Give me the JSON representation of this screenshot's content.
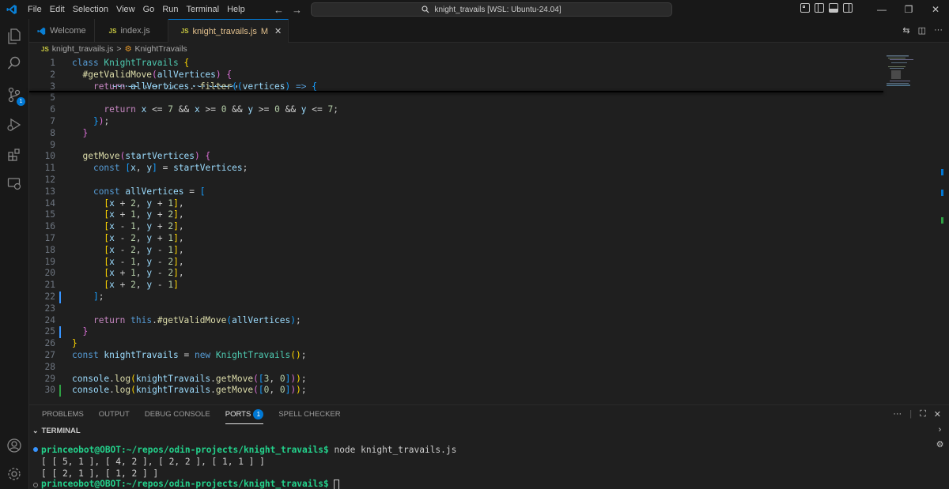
{
  "menu": [
    "File",
    "Edit",
    "Selection",
    "View",
    "Go",
    "Run",
    "Terminal",
    "Help"
  ],
  "search": {
    "text": "knight_travails [WSL: Ubuntu-24.04]"
  },
  "tabs": [
    {
      "label": "Welcome",
      "icon": "vscode-logo-icon"
    },
    {
      "label": "index.js",
      "icon": "js"
    },
    {
      "label": "knight_travails.js",
      "icon": "js",
      "modified": "M",
      "active": true
    }
  ],
  "js_badge": "JS",
  "breadcrumb": {
    "file": "knight_travails.js",
    "separator": ">",
    "symbol": "KnightTravails"
  },
  "editor_lines": [
    {
      "n": "1",
      "parts": [
        [
          "k",
          "class "
        ],
        [
          "cls",
          "KnightTravails "
        ],
        [
          "p",
          "{"
        ]
      ]
    },
    {
      "n": "2",
      "parts": [
        [
          "",
          "  "
        ],
        [
          "f",
          "#getValidMove"
        ],
        [
          "p2",
          "("
        ],
        [
          "v",
          "allVertices"
        ],
        [
          "p2",
          ")"
        ],
        [
          "",
          " "
        ],
        [
          "p2",
          "{"
        ]
      ]
    },
    {
      "n": "3",
      "parts": [
        [
          "",
          "    "
        ],
        [
          "c",
          "return "
        ],
        [
          "v",
          "allVertices"
        ],
        [
          "",
          ". "
        ],
        [
          "f",
          "filter"
        ],
        [
          "p3",
          "(("
        ],
        [
          "v",
          "vertices"
        ],
        [
          "p3",
          ")"
        ],
        [
          "",
          " "
        ],
        [
          "k",
          "=>"
        ],
        [
          "",
          " "
        ],
        [
          "p3",
          "{"
        ]
      ]
    },
    {
      "n": "5",
      "parts": []
    },
    {
      "n": "6",
      "parts": [
        [
          "",
          "      "
        ],
        [
          "c",
          "return "
        ],
        [
          "v",
          "x "
        ],
        [
          "",
          "<= "
        ],
        [
          "n",
          "7 "
        ],
        [
          "",
          "&& "
        ],
        [
          "v",
          "x "
        ],
        [
          "",
          ">= "
        ],
        [
          "n",
          "0 "
        ],
        [
          "",
          "&& "
        ],
        [
          "v",
          "y "
        ],
        [
          "",
          ">= "
        ],
        [
          "n",
          "0 "
        ],
        [
          "",
          "&& "
        ],
        [
          "v",
          "y "
        ],
        [
          "",
          "<= "
        ],
        [
          "n",
          "7"
        ],
        [
          "",
          ";"
        ]
      ]
    },
    {
      "n": "7",
      "parts": [
        [
          "",
          "    "
        ],
        [
          "p3",
          "}"
        ],
        [
          "p2",
          ")"
        ],
        [
          "",
          ";"
        ]
      ]
    },
    {
      "n": "8",
      "parts": [
        [
          "",
          "  "
        ],
        [
          "p2",
          "}"
        ]
      ]
    },
    {
      "n": "9",
      "parts": []
    },
    {
      "n": "10",
      "parts": [
        [
          "",
          "  "
        ],
        [
          "f",
          "getMove"
        ],
        [
          "p2",
          "("
        ],
        [
          "v",
          "startVertices"
        ],
        [
          "p2",
          ")"
        ],
        [
          "",
          " "
        ],
        [
          "p2",
          "{"
        ]
      ]
    },
    {
      "n": "11",
      "parts": [
        [
          "",
          "    "
        ],
        [
          "k",
          "const "
        ],
        [
          "p3",
          "["
        ],
        [
          "v",
          "x"
        ],
        [
          "",
          ", "
        ],
        [
          "v",
          "y"
        ],
        [
          "p3",
          "]"
        ],
        [
          "",
          " = "
        ],
        [
          "v",
          "startVertices"
        ],
        [
          "",
          ";"
        ]
      ]
    },
    {
      "n": "12",
      "parts": []
    },
    {
      "n": "13",
      "parts": [
        [
          "",
          "    "
        ],
        [
          "k",
          "const "
        ],
        [
          "v",
          "allVertices "
        ],
        [
          "",
          "= "
        ],
        [
          "p3",
          "["
        ]
      ]
    },
    {
      "n": "14",
      "parts": [
        [
          "",
          "      "
        ],
        [
          "p",
          "["
        ],
        [
          "v",
          "x "
        ],
        [
          "",
          "+ "
        ],
        [
          "n",
          "2"
        ],
        [
          "",
          ", "
        ],
        [
          "v",
          "y "
        ],
        [
          "",
          "+ "
        ],
        [
          "n",
          "1"
        ],
        [
          "p",
          "]"
        ],
        [
          "",
          ","
        ]
      ]
    },
    {
      "n": "15",
      "parts": [
        [
          "",
          "      "
        ],
        [
          "p",
          "["
        ],
        [
          "v",
          "x "
        ],
        [
          "",
          "+ "
        ],
        [
          "n",
          "1"
        ],
        [
          "",
          ", "
        ],
        [
          "v",
          "y "
        ],
        [
          "",
          "+ "
        ],
        [
          "n",
          "2"
        ],
        [
          "p",
          "]"
        ],
        [
          "",
          ","
        ]
      ]
    },
    {
      "n": "16",
      "parts": [
        [
          "",
          "      "
        ],
        [
          "p",
          "["
        ],
        [
          "v",
          "x "
        ],
        [
          "",
          "- "
        ],
        [
          "n",
          "1"
        ],
        [
          "",
          ", "
        ],
        [
          "v",
          "y "
        ],
        [
          "",
          "+ "
        ],
        [
          "n",
          "2"
        ],
        [
          "p",
          "]"
        ],
        [
          "",
          ","
        ]
      ]
    },
    {
      "n": "17",
      "parts": [
        [
          "",
          "      "
        ],
        [
          "p",
          "["
        ],
        [
          "v",
          "x "
        ],
        [
          "",
          "- "
        ],
        [
          "n",
          "2"
        ],
        [
          "",
          ", "
        ],
        [
          "v",
          "y "
        ],
        [
          "",
          "+ "
        ],
        [
          "n",
          "1"
        ],
        [
          "p",
          "]"
        ],
        [
          "",
          ","
        ]
      ]
    },
    {
      "n": "18",
      "parts": [
        [
          "",
          "      "
        ],
        [
          "p",
          "["
        ],
        [
          "v",
          "x "
        ],
        [
          "",
          "- "
        ],
        [
          "n",
          "2"
        ],
        [
          "",
          ", "
        ],
        [
          "v",
          "y "
        ],
        [
          "",
          "- "
        ],
        [
          "n",
          "1"
        ],
        [
          "p",
          "]"
        ],
        [
          "",
          ","
        ]
      ]
    },
    {
      "n": "19",
      "parts": [
        [
          "",
          "      "
        ],
        [
          "p",
          "["
        ],
        [
          "v",
          "x "
        ],
        [
          "",
          "- "
        ],
        [
          "n",
          "1"
        ],
        [
          "",
          ", "
        ],
        [
          "v",
          "y "
        ],
        [
          "",
          "- "
        ],
        [
          "n",
          "2"
        ],
        [
          "p",
          "]"
        ],
        [
          "",
          ","
        ]
      ]
    },
    {
      "n": "20",
      "parts": [
        [
          "",
          "      "
        ],
        [
          "p",
          "["
        ],
        [
          "v",
          "x "
        ],
        [
          "",
          "+ "
        ],
        [
          "n",
          "1"
        ],
        [
          "",
          ", "
        ],
        [
          "v",
          "y "
        ],
        [
          "",
          "- "
        ],
        [
          "n",
          "2"
        ],
        [
          "p",
          "]"
        ],
        [
          "",
          ","
        ]
      ]
    },
    {
      "n": "21",
      "parts": [
        [
          "",
          "      "
        ],
        [
          "p",
          "["
        ],
        [
          "v",
          "x "
        ],
        [
          "",
          "+ "
        ],
        [
          "n",
          "2"
        ],
        [
          "",
          ", "
        ],
        [
          "v",
          "y "
        ],
        [
          "",
          "- "
        ],
        [
          "n",
          "1"
        ],
        [
          "p",
          "]"
        ]
      ]
    },
    {
      "n": "22",
      "parts": [
        [
          "",
          "    "
        ],
        [
          "p3",
          "]"
        ],
        [
          "",
          ";"
        ]
      ]
    },
    {
      "n": "23",
      "parts": []
    },
    {
      "n": "24",
      "parts": [
        [
          "",
          "    "
        ],
        [
          "c",
          "return "
        ],
        [
          "k",
          "this"
        ],
        [
          "",
          "."
        ],
        [
          "f",
          "#getValidMove"
        ],
        [
          "p3",
          "("
        ],
        [
          "v",
          "allVertices"
        ],
        [
          "p3",
          ")"
        ],
        [
          "",
          ";"
        ]
      ]
    },
    {
      "n": "25",
      "parts": [
        [
          "",
          "  "
        ],
        [
          "p2",
          "}"
        ]
      ]
    },
    {
      "n": "26",
      "parts": [
        [
          "p",
          "}"
        ]
      ]
    },
    {
      "n": "27",
      "parts": [
        [
          "k",
          "const "
        ],
        [
          "v",
          "knightTravails "
        ],
        [
          "",
          "= "
        ],
        [
          "k",
          "new "
        ],
        [
          "cls",
          "KnightTravails"
        ],
        [
          "p",
          "()"
        ],
        [
          "",
          ";"
        ]
      ]
    },
    {
      "n": "28",
      "parts": []
    },
    {
      "n": "29",
      "parts": [
        [
          "v",
          "console"
        ],
        [
          "",
          "."
        ],
        [
          "f",
          "log"
        ],
        [
          "p",
          "("
        ],
        [
          "v",
          "knightTravails"
        ],
        [
          "",
          "."
        ],
        [
          "f",
          "getMove"
        ],
        [
          "p2",
          "("
        ],
        [
          "p3",
          "["
        ],
        [
          "n",
          "3"
        ],
        [
          "",
          ", "
        ],
        [
          "n",
          "0"
        ],
        [
          "p3",
          "]"
        ],
        [
          "p2",
          ")"
        ],
        [
          "p",
          ")"
        ],
        [
          "",
          ";"
        ]
      ]
    },
    {
      "n": "30",
      "parts": [
        [
          "v",
          "console"
        ],
        [
          "",
          "."
        ],
        [
          "f",
          "log"
        ],
        [
          "p",
          "("
        ],
        [
          "v",
          "knightTravails"
        ],
        [
          "",
          "."
        ],
        [
          "f",
          "getMove"
        ],
        [
          "p2",
          "("
        ],
        [
          "p3",
          "["
        ],
        [
          "n",
          "0"
        ],
        [
          "",
          ", "
        ],
        [
          "n",
          "0"
        ],
        [
          "p3",
          "]"
        ],
        [
          "p2",
          ")"
        ],
        [
          "p",
          ")"
        ],
        [
          "",
          ";"
        ]
      ]
    }
  ],
  "hidden_line": "const [x, y] = vertices;",
  "panel_tabs": [
    {
      "label": "PROBLEMS"
    },
    {
      "label": "OUTPUT"
    },
    {
      "label": "DEBUG CONSOLE"
    },
    {
      "label": "PORTS",
      "badge": "1",
      "active": true
    },
    {
      "label": "SPELL CHECKER"
    }
  ],
  "panel_more": "···",
  "terminal_header": "TERMINAL",
  "terminal": {
    "prompt": "princeobot@OBOT:~/repos/odin-projects/knight_travails$",
    "command": " node knight_travails.js",
    "out1": "[ [ 5, 1 ], [ 4, 2 ], [ 2, 2 ], [ 1, 1 ] ]",
    "out2": "[ [ 2, 1 ], [ 1, 2 ] ]"
  },
  "colors": {
    "accent": "#0078d4",
    "prompt": "#23d18b",
    "modified": "#e2c08d"
  }
}
